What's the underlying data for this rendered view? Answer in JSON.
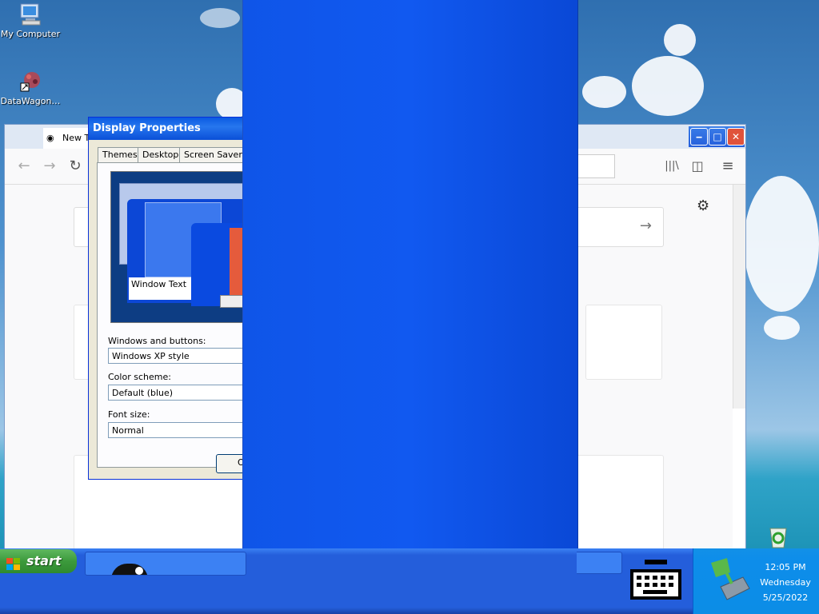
{
  "desktop": {
    "icons": [
      {
        "label": "My Computer",
        "icon": "computer-icon"
      },
      {
        "label": "DataWagon…",
        "icon": "shortcut-icon"
      }
    ],
    "recycle_icon": "recycle-bin-icon"
  },
  "browser": {
    "tab_label": "New Ta",
    "nav": {
      "back": "←",
      "forward": "→",
      "reload": "↻"
    },
    "toolbar": {
      "library": "|||\\",
      "sidebar": "◫",
      "menu": "≡"
    },
    "window_controls": {
      "minimize": "‒",
      "maximize": "□",
      "close": "✕"
    },
    "settings_glyph": "⚙",
    "search_arrow": "→"
  },
  "dialog": {
    "title": "Display Properties",
    "tabs": [
      "Themes",
      "Desktop",
      "Screen Saver"
    ],
    "preview": {
      "window_text": "Window Text"
    },
    "windows_buttons_label": "Windows and buttons:",
    "windows_buttons_value": "Windows XP style",
    "color_scheme_label": "Color scheme:",
    "color_scheme_value": "Default (blue)",
    "font_size_label": "Font size:",
    "font_size_value": "Normal",
    "ok_label": "O"
  },
  "taskbar": {
    "start_label": "start",
    "clock": {
      "time": "12:05 PM",
      "day": "Wednesday",
      "date": "5/25/2022"
    }
  }
}
